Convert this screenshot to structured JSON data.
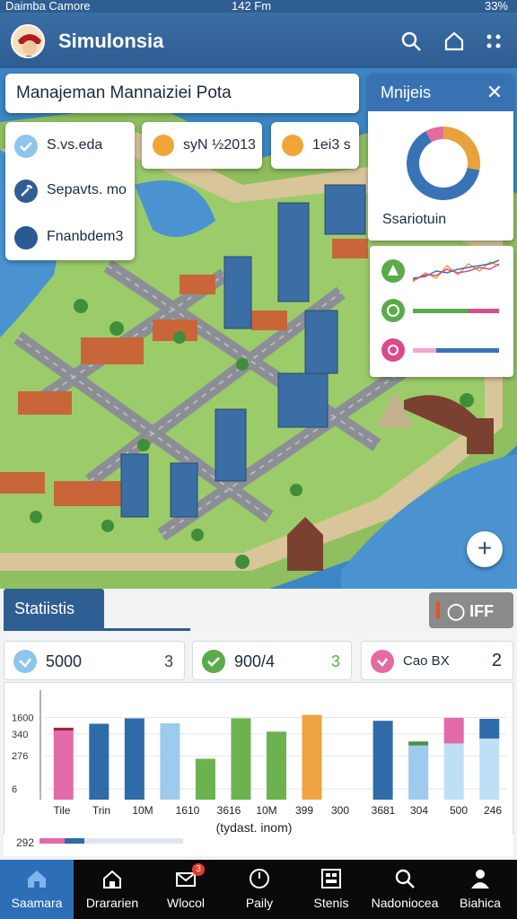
{
  "status_bar": {
    "carrier": "Daimba Camore",
    "time": "142 Fm",
    "battery": "33%"
  },
  "app_bar": {
    "title": "Simulonsia",
    "icons": [
      "search-icon",
      "home-icon",
      "more-icon"
    ]
  },
  "map_title": "Manajeman Mannaiziei Pota",
  "legend": [
    {
      "label": "S.vs.eda",
      "icon": "check-icon",
      "color": "#8ec5ea"
    },
    {
      "label": "Sepavts. mo",
      "icon": "wrench-icon",
      "color": "#2f5e92"
    },
    {
      "label": "Fnanbdem3",
      "icon": "circle-icon",
      "color": "#2a5a94"
    }
  ],
  "chips": [
    {
      "label": "syN ½2013",
      "color": "#f1a43a"
    },
    {
      "label": "1ei3 s",
      "color": "#f1a43a"
    }
  ],
  "side_panel": {
    "title": "Mnijeis",
    "close": "✕",
    "donut_caption": "Ssariotuin",
    "donut": [
      {
        "value": 28,
        "color": "#e7a23d"
      },
      {
        "value": 64,
        "color": "#3a73b5"
      },
      {
        "value": 8,
        "color": "#e56aa3"
      }
    ]
  },
  "trend_panel": {
    "rows": [
      {
        "icon": "pyramid-icon",
        "color": "#5aab49"
      },
      {
        "icon": "circle-icon",
        "color": "#5aab49"
      },
      {
        "icon": "gear-icon",
        "color": "#d84c8c"
      }
    ]
  },
  "fab": "+",
  "stats": {
    "tab": "Statiistis",
    "toggle": "◯ IFF",
    "kpis": [
      {
        "value": "5000",
        "count": "3",
        "color": "#8ec5ea",
        "icon": "check-icon"
      },
      {
        "value": "900/4",
        "count": "3",
        "count_color": "#5aab49",
        "color": "#5aab49",
        "icon": "check-icon"
      },
      {
        "value": "Cao BX",
        "count": "2",
        "color": "#e56aa3",
        "icon": "check-icon"
      }
    ],
    "footer_value": "292"
  },
  "chart_data": {
    "type": "bar",
    "categories": [
      "Tile",
      "Trin",
      "10M",
      "1610",
      "3616",
      "10M",
      "399",
      "300",
      "3681",
      "304",
      "500",
      "246"
    ],
    "xlabel": "(tydast. inom)",
    "yticks": [
      "1600",
      "340",
      "276",
      "6"
    ],
    "ylim": [
      0,
      1600
    ],
    "bars": [
      {
        "value": 1400,
        "color": "#e36aa8",
        "cap": 60,
        "cap_color": "#a0243e"
      },
      {
        "value": 1540,
        "color": "#2f6ba8"
      },
      {
        "value": 1650,
        "color": "#2f6ba8"
      },
      {
        "value": 1550,
        "color": "#9ccbee"
      },
      {
        "value": 830,
        "color": "#6cb24f"
      },
      {
        "value": 1650,
        "color": "#6cb24f"
      },
      {
        "value": 1380,
        "color": "#6cb24f"
      },
      {
        "value": 1720,
        "color": "#f0a341"
      },
      {
        "value": 0,
        "color": "#ffffff"
      },
      {
        "value": 1600,
        "color": "#2f6ba8"
      },
      {
        "value": 1100,
        "color": "#9ccbee",
        "cap": 80,
        "cap_color": "#4e8f3c"
      },
      {
        "value": 1140,
        "color": "#bde0f6",
        "cap": 520,
        "cap_color": "#e36aa8"
      },
      {
        "value": 1240,
        "color": "#bde0f6",
        "cap": 400,
        "cap_color": "#2f6ba8"
      }
    ]
  },
  "bottom_nav": [
    {
      "label": "Saamara",
      "icon": "home-icon",
      "active": true
    },
    {
      "label": "Drararien",
      "icon": "house-icon"
    },
    {
      "label": "Wlocol",
      "icon": "mail-icon",
      "badge": "3"
    },
    {
      "label": "Paily",
      "icon": "clock-icon"
    },
    {
      "label": "Stenis",
      "icon": "grid-icon"
    },
    {
      "label": "Nadoniocea",
      "icon": "search-icon"
    },
    {
      "label": "Biahica",
      "icon": "person-icon"
    }
  ]
}
